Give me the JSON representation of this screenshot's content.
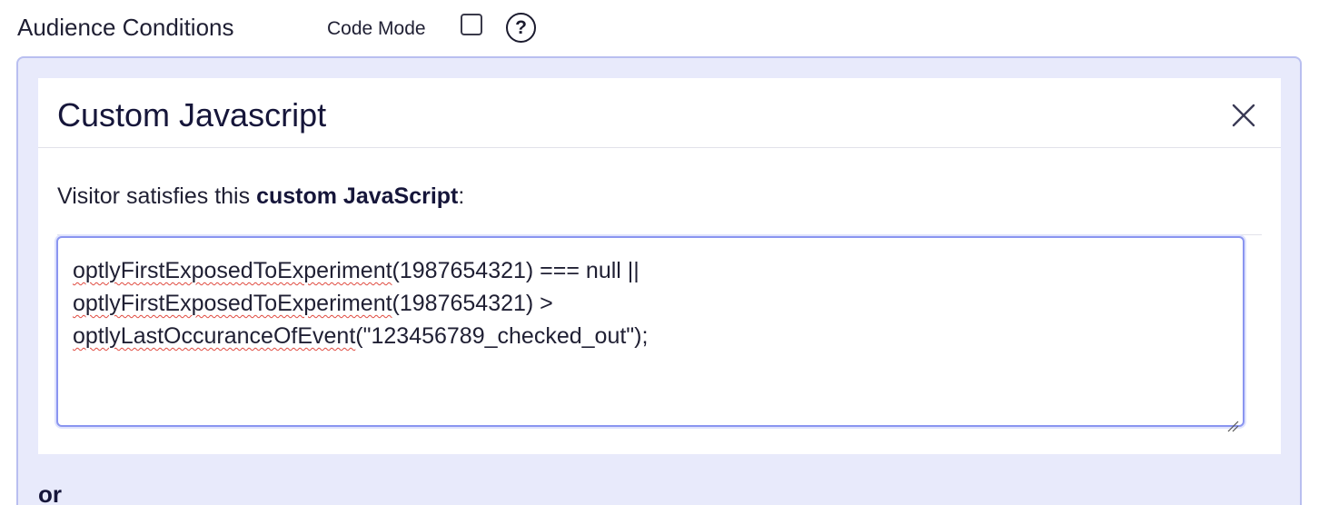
{
  "header": {
    "title": "Audience Conditions",
    "code_mode_label": "Code Mode",
    "code_mode_checked": false,
    "help_icon": "question-circle-icon",
    "help_glyph": "?"
  },
  "condition": {
    "title": "Custom Javascript",
    "close_icon": "close-icon",
    "description_prefix": "Visitor satisfies this ",
    "description_bold": "custom JavaScript",
    "description_suffix": ":",
    "code_lines": [
      {
        "fn": "optlyFirstExposedToExperiment",
        "rest": "(1987654321) === null ||"
      },
      {
        "fn": "optlyFirstExposedToExperiment",
        "rest": "(1987654321) >"
      },
      {
        "fn": "optlyLastOccuranceOfEvent",
        "rest": "(\"123456789_checked_out\");"
      }
    ]
  },
  "separator_label": "or",
  "colors": {
    "panel_bg": "#e8eafb",
    "panel_border": "#b9bff0",
    "editor_border": "#8a95f0",
    "spellcheck": "#e04a3f"
  }
}
